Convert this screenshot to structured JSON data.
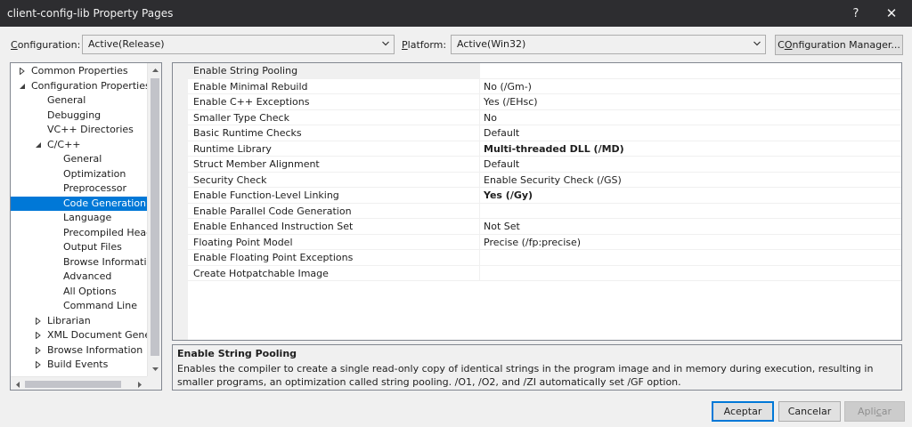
{
  "window": {
    "title": "client-config-lib Property Pages",
    "help": "?",
    "close": "✕"
  },
  "toolbar": {
    "configuration_label_u": "C",
    "configuration_label_rest": "onfiguration:",
    "configuration_value": "Active(Release)",
    "platform_label_u": "P",
    "platform_label_rest": "latform:",
    "platform_value": "Active(Win32)",
    "config_manager_u": "O",
    "config_manager_pre": "C",
    "config_manager_rest": "nfiguration Manager..."
  },
  "tree": {
    "items": [
      {
        "label": "Common Properties",
        "level": 0,
        "expander": "collapsed"
      },
      {
        "label": "Configuration Properties",
        "level": 0,
        "expander": "expanded"
      },
      {
        "label": "General",
        "level": 1,
        "expander": "none"
      },
      {
        "label": "Debugging",
        "level": 1,
        "expander": "none"
      },
      {
        "label": "VC++ Directories",
        "level": 1,
        "expander": "none"
      },
      {
        "label": "C/C++",
        "level": 1,
        "expander": "expanded"
      },
      {
        "label": "General",
        "level": 2,
        "expander": "none"
      },
      {
        "label": "Optimization",
        "level": 2,
        "expander": "none"
      },
      {
        "label": "Preprocessor",
        "level": 2,
        "expander": "none"
      },
      {
        "label": "Code Generation",
        "level": 2,
        "expander": "none",
        "selected": true
      },
      {
        "label": "Language",
        "level": 2,
        "expander": "none"
      },
      {
        "label": "Precompiled Heade",
        "level": 2,
        "expander": "none"
      },
      {
        "label": "Output Files",
        "level": 2,
        "expander": "none"
      },
      {
        "label": "Browse Information",
        "level": 2,
        "expander": "none"
      },
      {
        "label": "Advanced",
        "level": 2,
        "expander": "none"
      },
      {
        "label": "All Options",
        "level": 2,
        "expander": "none"
      },
      {
        "label": "Command Line",
        "level": 2,
        "expander": "none"
      },
      {
        "label": "Librarian",
        "level": 1,
        "expander": "collapsed"
      },
      {
        "label": "XML Document Genera",
        "level": 1,
        "expander": "collapsed"
      },
      {
        "label": "Browse Information",
        "level": 1,
        "expander": "collapsed"
      },
      {
        "label": "Build Events",
        "level": 1,
        "expander": "collapsed"
      }
    ]
  },
  "properties": [
    {
      "name": "Enable String Pooling",
      "value": "",
      "bold": false
    },
    {
      "name": "Enable Minimal Rebuild",
      "value": "No (/Gm-)",
      "bold": false
    },
    {
      "name": "Enable C++ Exceptions",
      "value": "Yes (/EHsc)",
      "bold": false
    },
    {
      "name": "Smaller Type Check",
      "value": "No",
      "bold": false
    },
    {
      "name": "Basic Runtime Checks",
      "value": "Default",
      "bold": false
    },
    {
      "name": "Runtime Library",
      "value": "Multi-threaded DLL (/MD)",
      "bold": true
    },
    {
      "name": "Struct Member Alignment",
      "value": "Default",
      "bold": false
    },
    {
      "name": "Security Check",
      "value": "Enable Security Check (/GS)",
      "bold": false
    },
    {
      "name": "Enable Function-Level Linking",
      "value": "Yes (/Gy)",
      "bold": true
    },
    {
      "name": "Enable Parallel Code Generation",
      "value": "",
      "bold": false
    },
    {
      "name": "Enable Enhanced Instruction Set",
      "value": "Not Set",
      "bold": false
    },
    {
      "name": "Floating Point Model",
      "value": "Precise (/fp:precise)",
      "bold": false
    },
    {
      "name": "Enable Floating Point Exceptions",
      "value": "",
      "bold": false
    },
    {
      "name": "Create Hotpatchable Image",
      "value": "",
      "bold": false
    }
  ],
  "description": {
    "title": "Enable String Pooling",
    "text": "Enables the compiler to create a single read-only copy of identical strings in the program image and in memory during execution, resulting in smaller programs, an optimization called string pooling. /O1, /O2, and /ZI  automatically set /GF option."
  },
  "buttons": {
    "accept": "Aceptar",
    "cancel": "Cancelar",
    "apply_pre": "Apli",
    "apply_u": "c",
    "apply_rest": "ar"
  },
  "colors": {
    "titlebar": "#2d2d30",
    "selection": "#0078d7",
    "dialog_bg": "#f0f0f0"
  }
}
